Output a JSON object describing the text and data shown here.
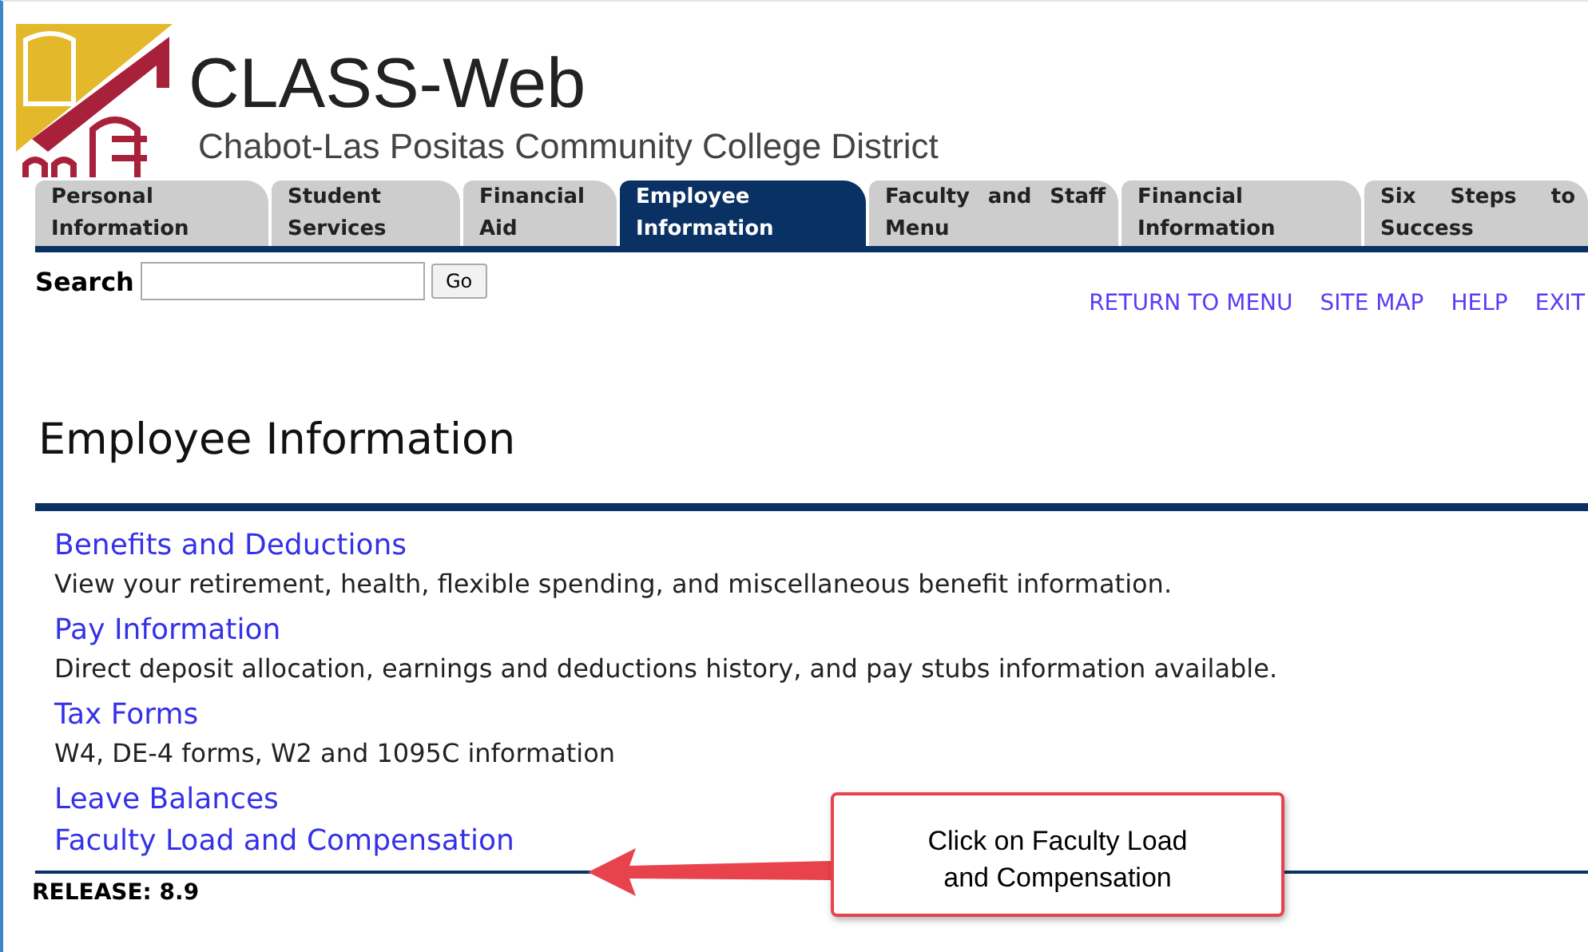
{
  "header": {
    "title": "CLASS-Web",
    "subtitle": "Chabot-Las Positas Community College District"
  },
  "tabs": [
    {
      "label": "Personal Information",
      "selected": false
    },
    {
      "label": "Student Services",
      "selected": false
    },
    {
      "label": "Financial Aid",
      "selected": false
    },
    {
      "label": "Employee Information",
      "selected": true
    },
    {
      "label": "Faculty and Staff Menu",
      "selected": false
    },
    {
      "label": "Financial Information",
      "selected": false
    },
    {
      "label": "Six Steps to Success",
      "selected": false
    }
  ],
  "search": {
    "label": "Search",
    "button": "Go"
  },
  "top_links": [
    "RETURN TO MENU",
    "SITE MAP",
    "HELP",
    "EXIT"
  ],
  "page_title": "Employee Information",
  "menu": [
    {
      "link": "Benefits and Deductions",
      "description": "View your retirement, health, flexible spending, and miscellaneous benefit information."
    },
    {
      "link": "Pay Information",
      "description": "Direct deposit allocation, earnings and deductions history, and pay stubs information available."
    },
    {
      "link": "Tax Forms",
      "description": "W4, DE-4 forms, W2 and 1095C information"
    },
    {
      "link": "Leave Balances"
    },
    {
      "link": "Faculty Load and Compensation"
    }
  ],
  "callout": "Click on Faculty Load and Compensation",
  "release": "RELEASE: 8.9"
}
